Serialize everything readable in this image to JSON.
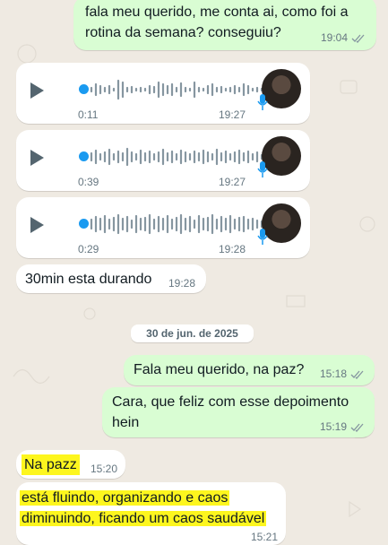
{
  "messages": [
    {
      "text_line1": "fala meu querido, me conta ai, como foi a",
      "text_line2": "rotina da semana? conseguiu?",
      "time": "19:04"
    },
    {
      "duration": "0:11",
      "time": "19:27"
    },
    {
      "duration": "0:39",
      "time": "19:27"
    },
    {
      "duration": "0:29",
      "time": "19:28"
    },
    {
      "text": "30min esta durando",
      "time": "19:28"
    },
    {
      "text": "Fala meu querido, na paz?",
      "time": "15:18"
    },
    {
      "text_line1": "Cara, que feliz com esse depoimento",
      "text_line2": "hein",
      "time": "15:19"
    },
    {
      "text": "Na pazz",
      "time": "15:20"
    },
    {
      "text_line1": "está fluindo, organizando e caos",
      "text_line2": "diminuindo, ficando um caos saudável",
      "time": "15:21"
    }
  ],
  "date_separator": "30 de jun. de 2025",
  "colors": {
    "outgoing": "#d9fdd3",
    "incoming": "#ffffff",
    "accent_blue": "#1a9af0",
    "highlight": "#fdf61e",
    "background": "#efeae2"
  },
  "icons": [
    "play-icon",
    "mic-icon",
    "double-check-icon"
  ]
}
